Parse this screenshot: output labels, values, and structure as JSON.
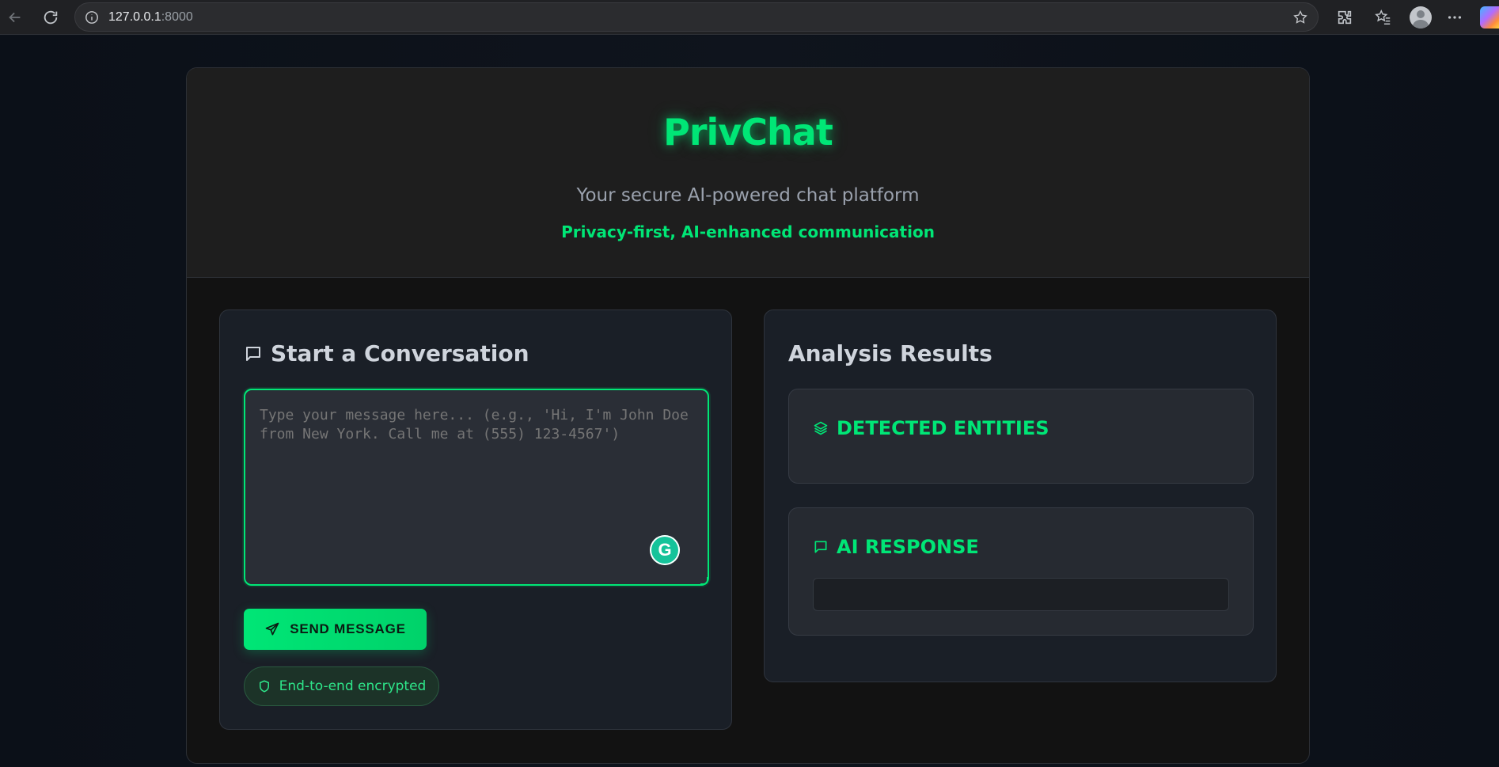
{
  "browser": {
    "url_host": "127.0.0.1",
    "url_port": ":8000"
  },
  "header": {
    "brand": "PrivChat",
    "tagline": "Your secure AI-powered chat platform",
    "subtagline": "Privacy-first, AI-enhanced communication"
  },
  "compose": {
    "title": "Start a Conversation",
    "placeholder": "Type your message here... (e.g., 'Hi, I'm John Doe from New York. Call me at (555) 123-4567')",
    "value": "",
    "send_label": "SEND MESSAGE",
    "encryption_badge": "End-to-end encrypted",
    "grammarly_letter": "G"
  },
  "results": {
    "title": "Analysis Results",
    "entities_heading": "DETECTED ENTITIES",
    "ai_response_heading": "AI RESPONSE",
    "ai_response_text": ""
  },
  "colors": {
    "accent": "#00e676",
    "background": "#121212",
    "panel": "#1a1f27"
  },
  "icons": {
    "compose_title": "message-square-icon",
    "send": "send-icon",
    "encryption": "shield-icon",
    "entities": "layers-icon",
    "ai_response": "message-square-icon"
  }
}
